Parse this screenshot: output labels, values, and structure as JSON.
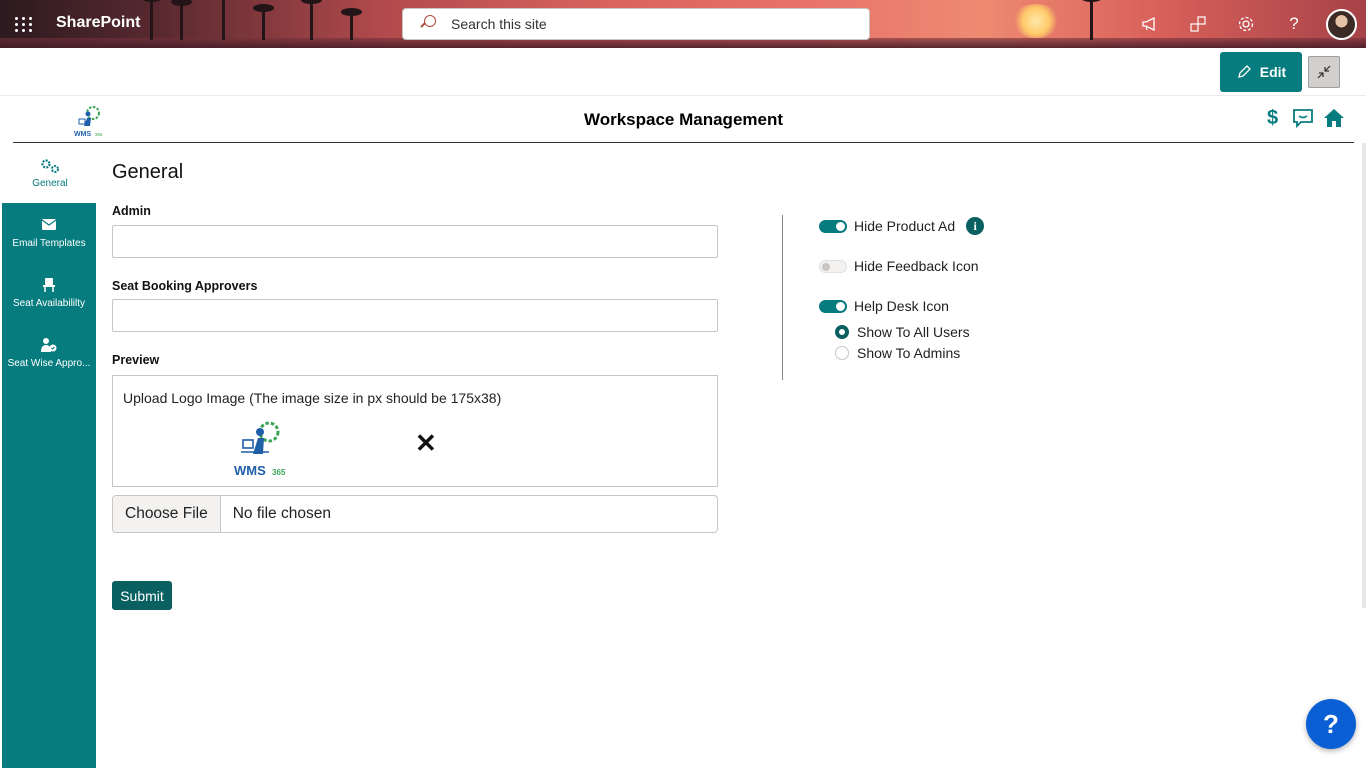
{
  "suitebar": {
    "brand": "SharePoint",
    "search_placeholder": "Search this site",
    "icons": [
      "waffle-icon",
      "megaphone-icon",
      "share-icon",
      "gear-icon",
      "help-icon"
    ]
  },
  "commandbar": {
    "edit_label": "Edit"
  },
  "app": {
    "title": "Workspace Management",
    "header_icons": [
      "dollar-icon",
      "feedback-icon",
      "home-icon"
    ],
    "accent": "#077c7f"
  },
  "sidebar": {
    "items": [
      {
        "label": "General",
        "icon": "gears-icon",
        "active": true
      },
      {
        "label": "Email Templates",
        "icon": "envelope-icon",
        "active": false
      },
      {
        "label": "Seat Availabililty",
        "icon": "chair-icon",
        "active": false
      },
      {
        "label": "Seat Wise Appro...",
        "icon": "user-check-icon",
        "active": false
      }
    ]
  },
  "main": {
    "section_title": "General",
    "admin_label": "Admin",
    "admin_value": "",
    "approvers_label": "Seat Booking Approvers",
    "approvers_value": "",
    "preview_label": "Preview",
    "upload_text": "Upload Logo Image (The image size in px should be 175x38)",
    "logo_text": "WMS",
    "logo_suffix": "365",
    "remove_symbol": "✕",
    "file_button": "Choose File",
    "file_status": "No file chosen",
    "submit_label": "Submit"
  },
  "settings": {
    "hide_product_ad": {
      "label": "Hide Product Ad",
      "on": true
    },
    "hide_feedback_icon": {
      "label": "Hide Feedback Icon",
      "on": false
    },
    "help_desk_icon": {
      "label": "Help Desk Icon",
      "on": true
    },
    "visibility_options": [
      {
        "label": "Show To All Users",
        "selected": true
      },
      {
        "label": "Show To Admins",
        "selected": false
      }
    ],
    "info_symbol": "i"
  },
  "help_fab": "?"
}
